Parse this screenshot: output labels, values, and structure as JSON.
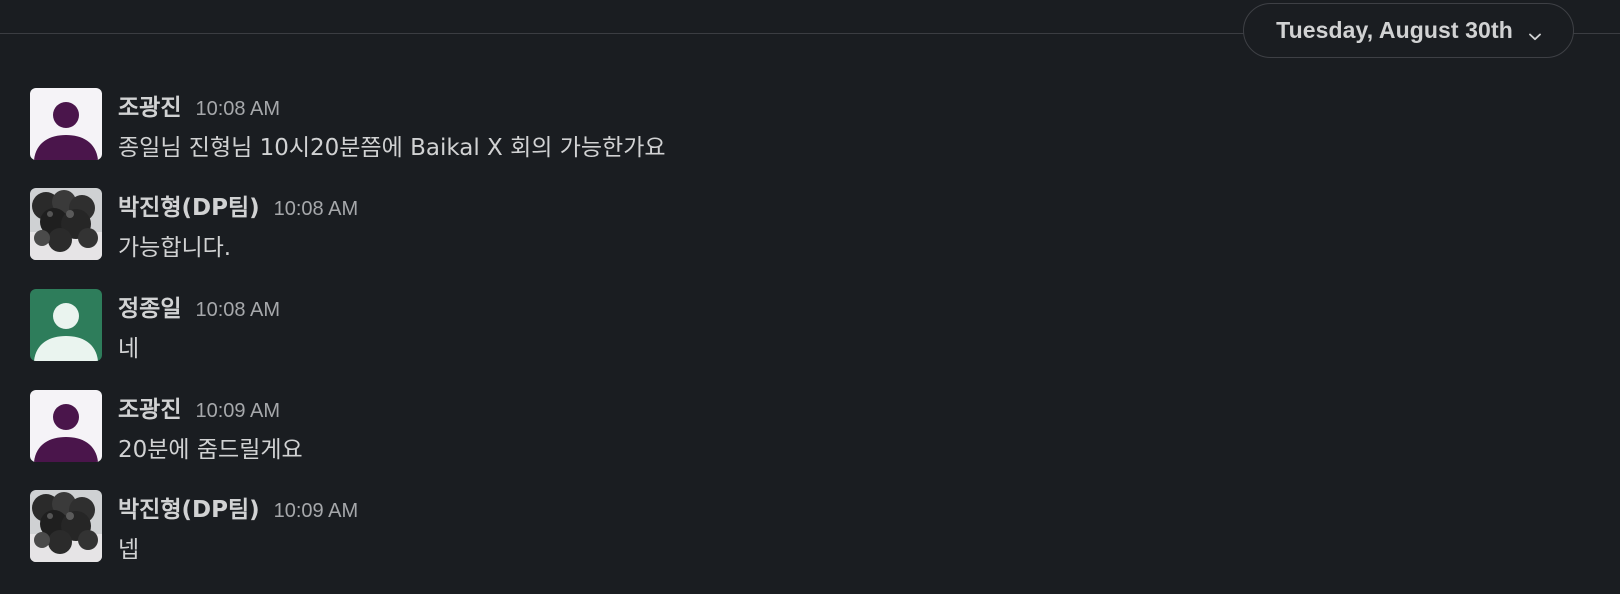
{
  "date_divider": {
    "label": "Tuesday, August 30th",
    "chevron_icon": "chevron-down-icon"
  },
  "colors": {
    "background": "#1a1d21",
    "text": "#d1d2d3",
    "timestamp": "#a6a8ab",
    "avatar_purple_bg": "#f5f3f7",
    "avatar_purple_fg": "#4a154b",
    "avatar_green_bg": "#2e7d5b",
    "avatar_green_fg": "#eaf4ef"
  },
  "messages": [
    {
      "sender": "조광진",
      "time": "10:08 AM",
      "text": "종일님 진형님 10시20분쯤에 Baikal X 회의 가능한가요",
      "avatar": "default-avatar-purple"
    },
    {
      "sender": "박진형(DP팀)",
      "time": "10:08 AM",
      "text": "가능합니다.",
      "avatar": "photo-avatar"
    },
    {
      "sender": "정종일",
      "time": "10:08 AM",
      "text": "네",
      "avatar": "default-avatar-green"
    },
    {
      "sender": "조광진",
      "time": "10:09 AM",
      "text": "20분에 줌드릴게요",
      "avatar": "default-avatar-purple"
    },
    {
      "sender": "박진형(DP팀)",
      "time": "10:09 AM",
      "text": "넵",
      "avatar": "photo-avatar"
    }
  ]
}
